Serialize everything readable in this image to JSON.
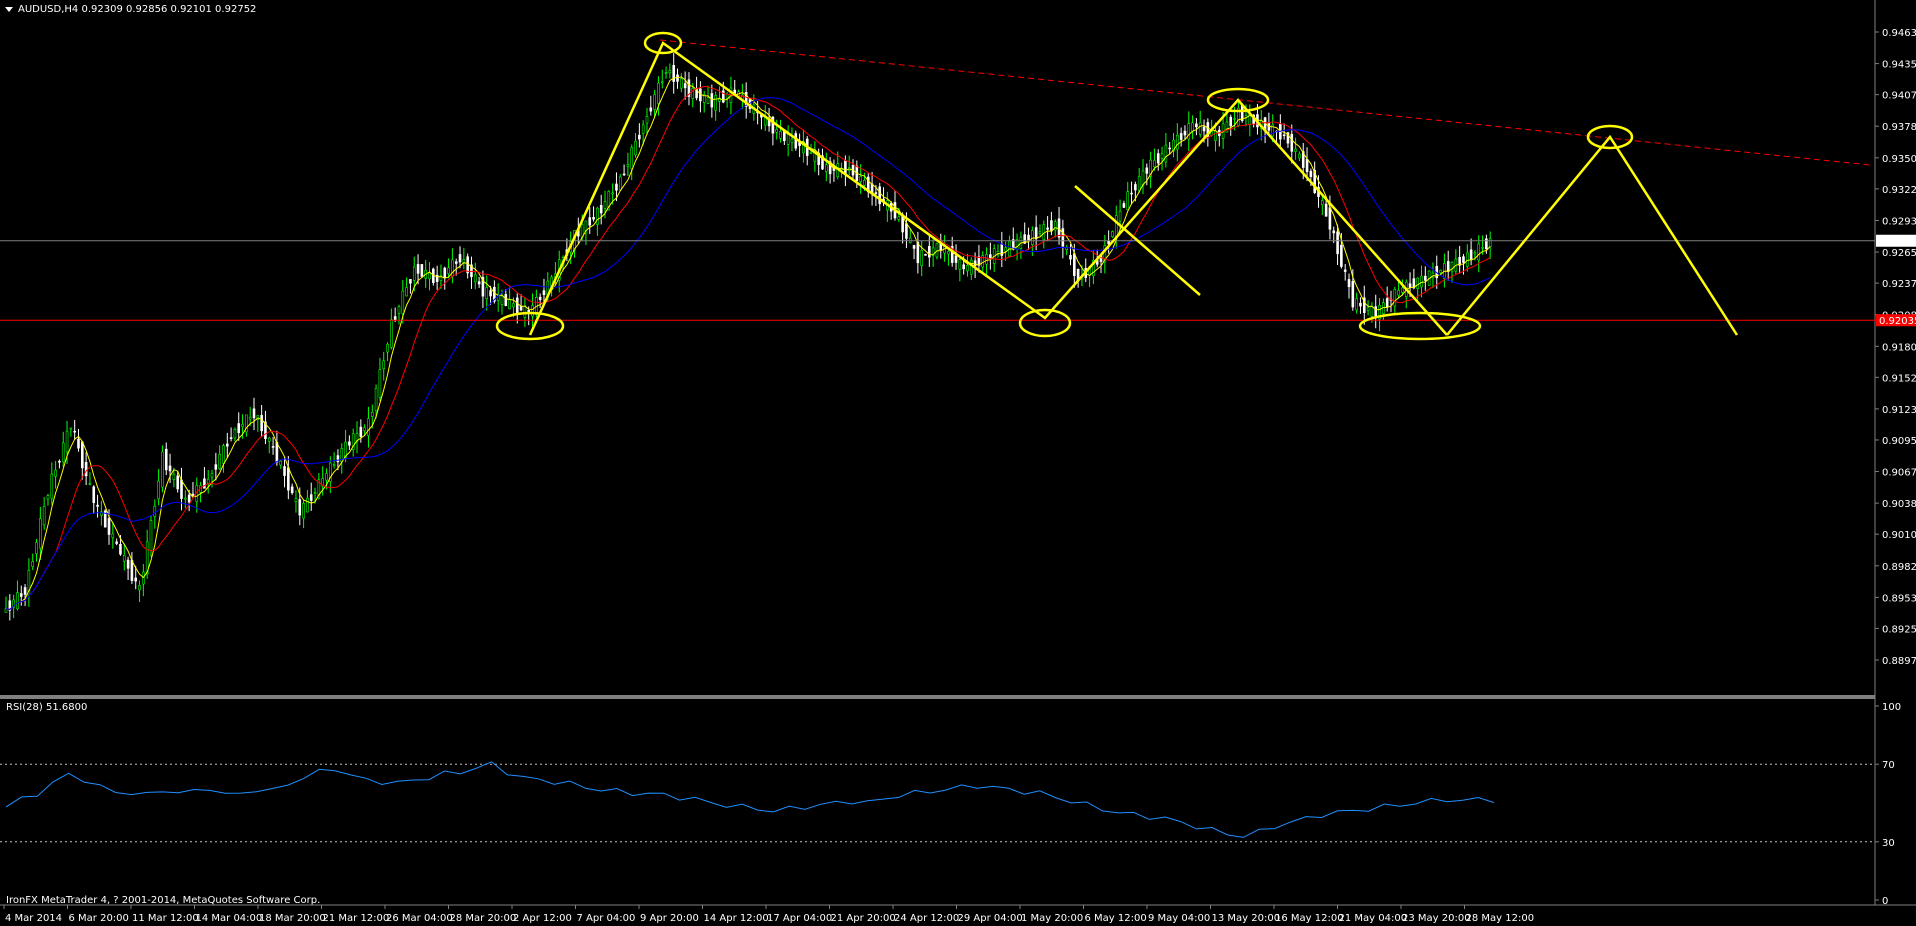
{
  "header": {
    "title": "AUDUSD,H4  0.92309 0.92856 0.92101 0.92752"
  },
  "rsi_panel": {
    "label": "RSI(28) 51.6800"
  },
  "footer": {
    "text": "IronFX MetaTrader 4, ? 2001-2014, MetaQuotes Software Corp."
  },
  "colors": {
    "background": "#000000",
    "bull_candle": "#00ff00",
    "bear_candle": "#ffffff",
    "fast_ma": "#ffff00",
    "mid_ma": "#ff0000",
    "slow_ma": "#0000ff",
    "rsi_line": "#1e90ff",
    "pattern": "#ffff00",
    "support": "#ff0000",
    "trendline": "#ff0000",
    "price_line": "#808080",
    "current_price_tag": "#ffffff",
    "support_tag": "#ff0000"
  },
  "chart_data": [
    {
      "type": "line",
      "symbol": "AUDUSD",
      "timeframe": "H4",
      "ohlc_last": {
        "open": 0.92309,
        "high": 0.92856,
        "low": 0.92101,
        "close": 0.92752
      },
      "ylim": [
        0.8897,
        0.94635
      ],
      "y_ticks": [
        0.94635,
        0.9435,
        0.9407,
        0.93785,
        0.935,
        0.9322,
        0.92935,
        0.9265,
        0.9237,
        0.92085,
        0.918,
        0.9152,
        0.91235,
        0.90955,
        0.9067,
        0.90385,
        0.90105,
        0.8982,
        0.89535,
        0.89255,
        0.8897
      ],
      "x_ticks": [
        "4 Mar 2014",
        "6 Mar 20:00",
        "11 Mar 12:00",
        "14 Mar 04:00",
        "18 Mar 20:00",
        "21 Mar 12:00",
        "26 Mar 04:00",
        "28 Mar 20:00",
        "2 Apr 12:00",
        "7 Apr 04:00",
        "9 Apr 20:00",
        "14 Apr 12:00",
        "17 Apr 04:00",
        "21 Apr 20:00",
        "24 Apr 12:00",
        "29 Apr 04:00",
        "1 May 20:00",
        "6 May 12:00",
        "9 May 04:00",
        "13 May 20:00",
        "16 May 12:00",
        "21 May 04:00",
        "23 May 20:00",
        "28 May 12:00"
      ],
      "series": [
        {
          "name": "",
          "values": [
            0.894,
            0.896,
            0.905,
            0.911,
            0.904,
            0.9,
            0.896,
            0.908,
            0.904,
            0.906,
            0.91,
            0.912,
            0.908,
            0.903,
            0.906,
            0.909,
            0.911,
            0.92,
            0.925,
            0.924,
            0.926,
            0.923,
            0.922,
            0.921,
            0.924,
            0.928,
            0.93,
            0.933,
            0.938,
            0.943,
            0.941,
            0.94,
            0.941,
            0.939,
            0.937,
            0.936,
            0.934,
            0.934,
            0.932,
            0.93,
            0.926,
            0.927,
            0.925,
            0.926,
            0.927,
            0.928,
            0.929,
            0.924,
            0.926,
            0.931,
            0.934,
            0.936,
            0.938,
            0.937,
            0.939,
            0.938,
            0.937,
            0.934,
            0.929,
            0.922,
            0.921,
            0.923,
            0.924,
            0.925,
            0.926,
            0.9275
          ]
        }
      ],
      "current_price": 0.92752,
      "support_level": 0.92035,
      "pattern_points": [
        [
          0.9203,
          0.946
        ],
        [
          0.946,
          0.9425
        ],
        [
          0.9425,
          0.9208
        ],
        [
          0.9208,
          0.9402
        ],
        [
          0.9402,
          0.933
        ],
        [
          0.933,
          0.9203
        ],
        [
          0.9203,
          0.9371
        ],
        [
          0.9371,
          0.9203
        ]
      ],
      "pattern_labels": [
        "2 Apr 12:00",
        "9 Apr 20:00",
        "1 May 20:00",
        "13 May 20:00",
        "23 May 20:00"
      ],
      "trendline": {
        "from": [
          0.946,
          "9 Apr 20:00"
        ],
        "to": [
          0.935,
          "future"
        ]
      }
    },
    {
      "type": "line",
      "name": "RSI(28)",
      "last_value": 51.68,
      "ylim": [
        0,
        100
      ],
      "y_ticks": [
        100,
        70,
        30,
        0
      ],
      "levels": [
        70,
        30
      ],
      "values": [
        48,
        52,
        55,
        60,
        65,
        62,
        58,
        56,
        55,
        54,
        57,
        55,
        56,
        58,
        54,
        55,
        57,
        56,
        60,
        63,
        66,
        68,
        64,
        62,
        61,
        60,
        62,
        63,
        65,
        66,
        68,
        70,
        66,
        63,
        62,
        61,
        60,
        58,
        57,
        56,
        55,
        55,
        54,
        53,
        52,
        50,
        49,
        48,
        47,
        46,
        47,
        48,
        49,
        50,
        51,
        50,
        52,
        54,
        55,
        56,
        57,
        58,
        59,
        58,
        57,
        56,
        55,
        53,
        51,
        49,
        47,
        45,
        44,
        43,
        42,
        40,
        38,
        36,
        34,
        33,
        35,
        38,
        40,
        42,
        44,
        45,
        46,
        47,
        48,
        49,
        50,
        51,
        52,
        51,
        52,
        51.68
      ]
    }
  ]
}
